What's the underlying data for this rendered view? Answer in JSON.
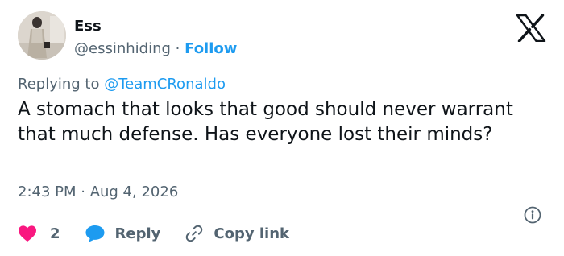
{
  "author": {
    "name": "Ess",
    "handle": "@essinhiding",
    "separator": "·",
    "follow_label": "Follow"
  },
  "logo": {
    "icon": "x-logo-icon"
  },
  "reply_context": {
    "prefix": "Replying to",
    "mention": "@TeamCRonaldo"
  },
  "tweet": {
    "text": "A stomach that looks that good should never warrant that much defense. Has everyone lost their minds?",
    "timestamp": "2:43 PM · Aug 4, 2026"
  },
  "actions": {
    "like_count": "2",
    "reply_label": "Reply",
    "copy_label": "Copy link"
  },
  "colors": {
    "accent": "#1d9bf0",
    "like": "#f91880",
    "secondary_text": "#536471",
    "primary_text": "#0f1419",
    "divider": "#cfd9de"
  }
}
